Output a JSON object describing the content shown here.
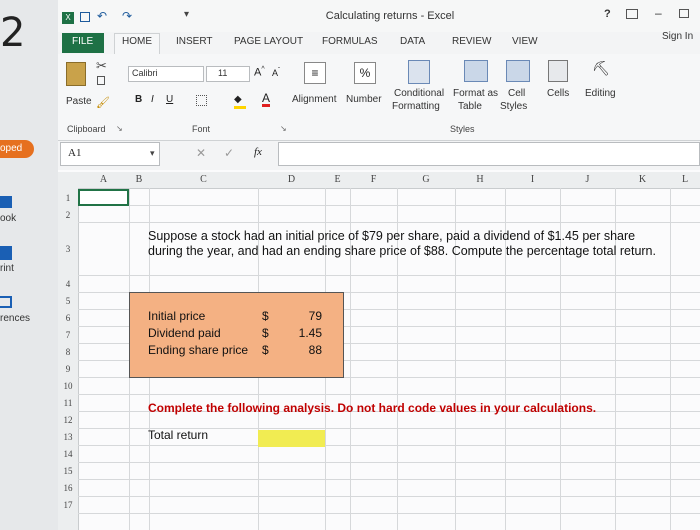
{
  "left_panel": {
    "items": [
      "oped",
      "ook",
      "rint",
      "rences"
    ],
    "big_number": "2"
  },
  "window": {
    "title": "Calculating returns - Excel",
    "help": "?",
    "sign_in": "Sign In"
  },
  "ribbon_tabs": [
    "FILE",
    "HOME",
    "INSERT",
    "PAGE LAYOUT",
    "FORMULAS",
    "DATA",
    "REVIEW",
    "VIEW"
  ],
  "ribbon": {
    "paste": "Paste",
    "clipboard": "Clipboard",
    "font_name": "Calibri",
    "font_size": "11",
    "font_group": "Font",
    "alignment": "Alignment",
    "number": "Number",
    "number_symbol": "%",
    "conditional": "Conditional",
    "formatting": "Formatting",
    "format_as": "Format as",
    "table": "Table",
    "cell": "Cell",
    "styles_btn": "Styles",
    "styles_group": "Styles",
    "cells": "Cells",
    "editing": "Editing"
  },
  "formula_bar": {
    "cell_ref": "A1",
    "fx": "fx",
    "value": ""
  },
  "sheet": {
    "columns": [
      "A",
      "B",
      "C",
      "D",
      "E",
      "F",
      "G",
      "H",
      "I",
      "J",
      "K",
      "L"
    ],
    "rows": [
      "1",
      "2",
      "3",
      "4",
      "5",
      "6",
      "7",
      "8",
      "9",
      "10",
      "11",
      "12",
      "13",
      "14",
      "15",
      "16",
      "17"
    ],
    "question": "Suppose a stock had an initial price of $79 per share, paid a dividend of $1.45 per share during the year, and had an ending share price of $88. Compute the percentage total return.",
    "inputs": [
      {
        "label": "Initial price",
        "currency": "$",
        "value": "79"
      },
      {
        "label": "Dividend paid",
        "currency": "$",
        "value": "1.45"
      },
      {
        "label": "Ending share price",
        "currency": "$",
        "value": "88"
      }
    ],
    "instruction": "Complete the following analysis. Do not hard code values in your calculations.",
    "total_return_label": "Total return",
    "colors": {
      "input_box": "#f4b183",
      "instruction": "#c00000",
      "highlight": "#f1ec52"
    }
  }
}
